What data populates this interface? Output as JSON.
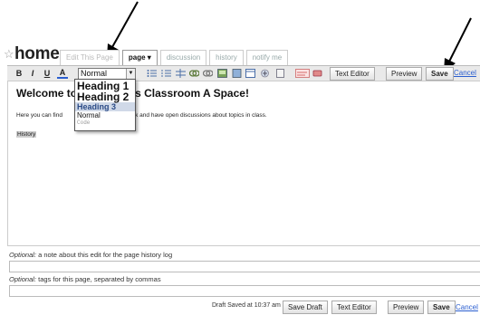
{
  "page": {
    "title": "home",
    "tabs": [
      "Edit This Page",
      "page",
      "discussion",
      "history",
      "notify me"
    ]
  },
  "toolbar": {
    "format_selected": "Normal",
    "buttons": [
      "B",
      "I",
      "U",
      "A"
    ],
    "text_editor": "Text Editor",
    "preview": "Preview",
    "save": "Save",
    "cancel": "Cancel"
  },
  "format_menu": {
    "options": [
      "Heading 1",
      "Heading 2",
      "Heading 3",
      "Normal",
      "Code"
    ],
    "highlighted": "Heading 3"
  },
  "editor": {
    "heading_start": "Welcome to",
    "heading_end": "s Classroom A Space!",
    "body_start": "Here you can find",
    "body_end": "rk and have open discussions about topics in class.",
    "link_text": "History"
  },
  "fields": {
    "note_prefix": "Optional:",
    "note_rest": " a note about this edit for the page history log",
    "tags_prefix": "Optional:",
    "tags_rest": " tags for this page, separated by commas"
  },
  "footer": {
    "status": "Draft Saved at 10:37 am",
    "save_draft": "Save Draft",
    "text_editor": "Text Editor",
    "preview": "Preview",
    "save": "Save",
    "cancel": "Cancel"
  },
  "colors": {
    "link": "#2a5ed0",
    "toolbar_bg": "#e9e9e9",
    "highlight": "#d0d9e8"
  }
}
